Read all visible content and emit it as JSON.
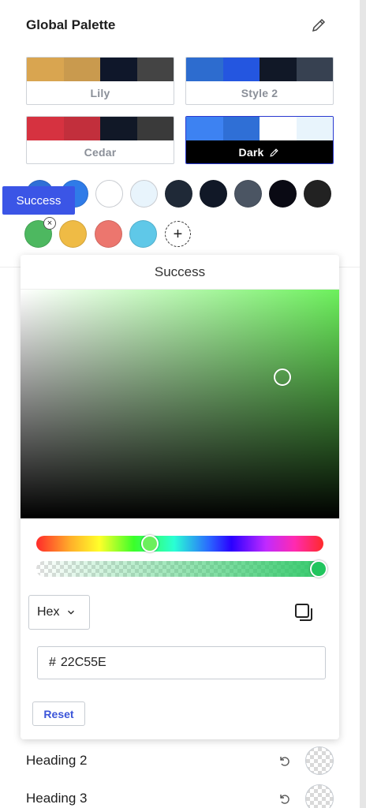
{
  "header": {
    "title": "Global Palette"
  },
  "palettes": [
    {
      "name": "Lily",
      "colors": [
        "#d9a550",
        "#c99a4e",
        "#0f172a",
        "#444444"
      ]
    },
    {
      "name": "Style 2",
      "colors": [
        "#2d6ccf",
        "#2456e0",
        "#111827",
        "#374151"
      ]
    },
    {
      "name": "Cedar",
      "colors": [
        "#d63240",
        "#c22f3c",
        "#111827",
        "#3a3a3a"
      ]
    },
    {
      "name": "Dark",
      "colors": [
        "#3d82f2",
        "#2f6fd6",
        "#ffffff",
        "#e8f4fc"
      ],
      "active": true
    }
  ],
  "swatches": [
    {
      "color": "#2f6fd6"
    },
    {
      "color": "#2f7be8"
    },
    {
      "color": "#ffffff"
    },
    {
      "color": "#e8f4fc"
    },
    {
      "color": "#1f2937"
    },
    {
      "color": "#111827"
    },
    {
      "color": "#4b5563"
    },
    {
      "color": "#0a0a14"
    },
    {
      "color": "#222222"
    },
    {
      "color": "#4db860"
    },
    {
      "color": "#efbb45"
    },
    {
      "color": "#ec766e"
    },
    {
      "color": "#5fc8e8"
    }
  ],
  "tooltip": {
    "text": "Success"
  },
  "picker": {
    "title": "Success",
    "format": "Hex",
    "hash": "#",
    "hex_value": "22C55E",
    "reset_label": "Reset",
    "alpha": 1.0
  },
  "headings": [
    {
      "label": "Heading 2"
    },
    {
      "label": "Heading 3"
    }
  ]
}
